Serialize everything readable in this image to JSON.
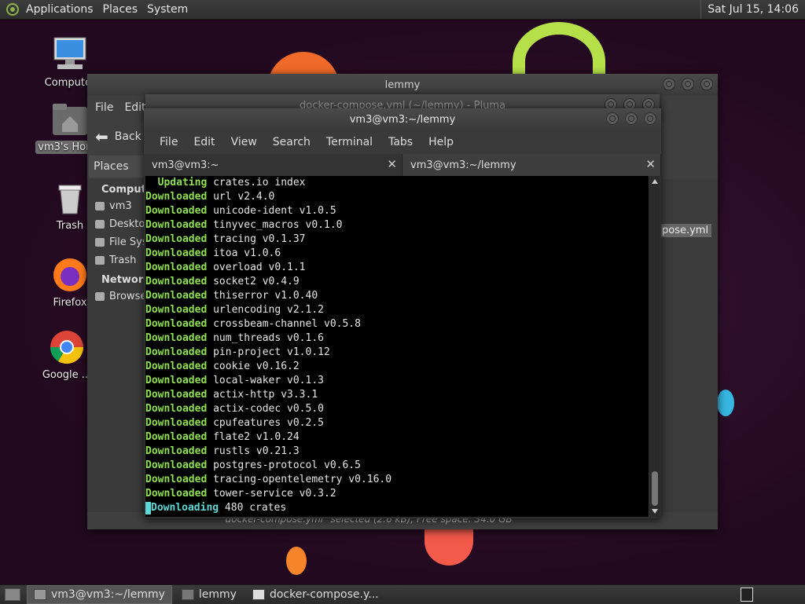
{
  "top_panel": {
    "menus": [
      "Applications",
      "Places",
      "System"
    ],
    "clock": "Sat Jul 15, 14:06"
  },
  "desktop_icons": [
    {
      "label": "Computer",
      "icon": "computer-icon"
    },
    {
      "label": "vm3's Home",
      "icon": "home-folder-icon"
    },
    {
      "label": "Trash",
      "icon": "trash-icon"
    },
    {
      "label": "Firefox",
      "icon": "firefox-icon"
    },
    {
      "label": "Google ...",
      "icon": "chrome-icon"
    }
  ],
  "caja": {
    "title": "lemmy",
    "menu": [
      "File",
      "Edit"
    ],
    "back_label": "Back",
    "places_label": "Places",
    "sidebar": {
      "sections": [
        {
          "title": "Computer",
          "items": [
            "vm3",
            "Desktop",
            "File System",
            "Trash"
          ]
        },
        {
          "title": "Network",
          "items": [
            "Browse Network"
          ]
        }
      ]
    },
    "selected_file": "pose.yml",
    "status": "\"docker-compose.yml\" selected (2.6 kB), Free space: 34.0 GB"
  },
  "pluma": {
    "title": "docker-compose.yml (~/lemmy) - Pluma"
  },
  "terminal": {
    "title": "vm3@vm3:~/lemmy",
    "menu": [
      "File",
      "Edit",
      "View",
      "Search",
      "Terminal",
      "Tabs",
      "Help"
    ],
    "tabs": [
      "vm3@vm3:~",
      "vm3@vm3:~/lemmy"
    ],
    "lines": [
      {
        "kw": "  Updating",
        "text": " crates.io index"
      },
      {
        "kw": "Downloaded",
        "text": " url v2.4.0"
      },
      {
        "kw": "Downloaded",
        "text": " unicode-ident v1.0.5"
      },
      {
        "kw": "Downloaded",
        "text": " tinyvec_macros v0.1.0"
      },
      {
        "kw": "Downloaded",
        "text": " tracing v0.1.37"
      },
      {
        "kw": "Downloaded",
        "text": " itoa v1.0.6"
      },
      {
        "kw": "Downloaded",
        "text": " overload v0.1.1"
      },
      {
        "kw": "Downloaded",
        "text": " socket2 v0.4.9"
      },
      {
        "kw": "Downloaded",
        "text": " thiserror v1.0.40"
      },
      {
        "kw": "Downloaded",
        "text": " urlencoding v2.1.2"
      },
      {
        "kw": "Downloaded",
        "text": " crossbeam-channel v0.5.8"
      },
      {
        "kw": "Downloaded",
        "text": " num_threads v0.1.6"
      },
      {
        "kw": "Downloaded",
        "text": " pin-project v1.0.12"
      },
      {
        "kw": "Downloaded",
        "text": " cookie v0.16.2"
      },
      {
        "kw": "Downloaded",
        "text": " local-waker v0.1.3"
      },
      {
        "kw": "Downloaded",
        "text": " actix-http v3.3.1"
      },
      {
        "kw": "Downloaded",
        "text": " actix-codec v0.5.0"
      },
      {
        "kw": "Downloaded",
        "text": " cpufeatures v0.2.5"
      },
      {
        "kw": "Downloaded",
        "text": " flate2 v1.0.24"
      },
      {
        "kw": "Downloaded",
        "text": " rustls v0.21.3"
      },
      {
        "kw": "Downloaded",
        "text": " postgres-protocol v0.6.5"
      },
      {
        "kw": "Downloaded",
        "text": " tracing-opentelemetry v0.16.0"
      },
      {
        "kw": "Downloaded",
        "text": " tower-service v0.3.2"
      }
    ],
    "last_line": {
      "kw": "Downloading",
      "text": " 480 crates"
    }
  },
  "taskbar": {
    "tasks": [
      {
        "label": "vm3@vm3:~/lemmy",
        "active": true
      },
      {
        "label": "lemmy",
        "active": false
      },
      {
        "label": "docker-compose.y...",
        "active": false
      }
    ]
  }
}
